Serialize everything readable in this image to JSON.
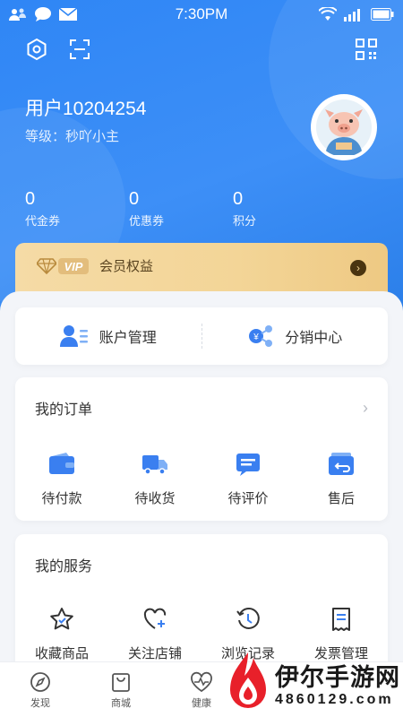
{
  "status_bar": {
    "time": "7:30PM",
    "icons": [
      "people-icon",
      "chat-bubble-icon",
      "mail-icon",
      "wifi-icon",
      "signal-icon",
      "battery-icon"
    ]
  },
  "header": {
    "top_icons": [
      "settings-hex-icon",
      "scan-icon",
      "qr-code-icon"
    ],
    "username": "用户10204254",
    "level": "等级：秒吖小主",
    "avatar_icon": "pig-avatar-icon"
  },
  "stats": [
    {
      "value": "0",
      "label": "代金券"
    },
    {
      "value": "0",
      "label": "优惠券"
    },
    {
      "value": "0",
      "label": "积分"
    }
  ],
  "vip": {
    "badge": "VIP",
    "label": "会员权益",
    "arrow_icon": "chevron-right-icon"
  },
  "account_card": {
    "items": [
      {
        "label": "账户管理",
        "icon": "user-list-icon"
      },
      {
        "label": "分销中心",
        "icon": "distribution-icon"
      }
    ]
  },
  "orders": {
    "title": "我的订单",
    "items": [
      {
        "label": "待付款",
        "icon": "wallet-icon"
      },
      {
        "label": "待收货",
        "icon": "truck-icon"
      },
      {
        "label": "待评价",
        "icon": "comment-icon"
      },
      {
        "label": "售后",
        "icon": "return-icon"
      }
    ]
  },
  "services": {
    "title": "我的服务",
    "items": [
      {
        "label": "收藏商品",
        "icon": "star-icon"
      },
      {
        "label": "关注店铺",
        "icon": "heart-plus-icon"
      },
      {
        "label": "浏览记录",
        "icon": "history-icon"
      },
      {
        "label": "发票管理",
        "icon": "invoice-icon"
      }
    ]
  },
  "bottom_nav": [
    {
      "label": "发现",
      "icon": "compass-icon"
    },
    {
      "label": "商城",
      "icon": "bag-icon"
    },
    {
      "label": "健康",
      "icon": "heartbeat-icon"
    }
  ],
  "watermark": {
    "title": "伊尔手游网",
    "sub": "4860129.com"
  },
  "colors": {
    "primary": "#2f86f5",
    "vip_gold": "#f3d597",
    "icon_blue": "#3a7ff0"
  }
}
